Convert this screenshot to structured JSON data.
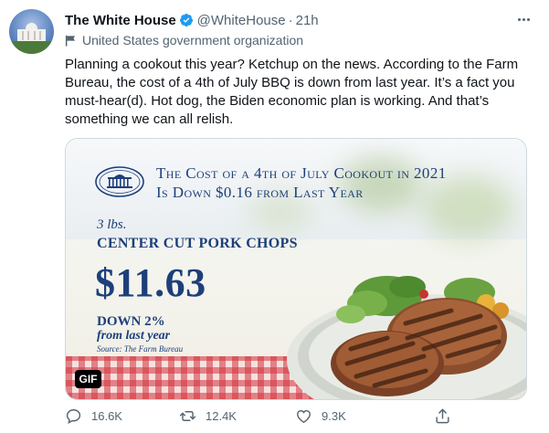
{
  "tweet": {
    "author_name": "The White House",
    "handle": "@WhiteHouse",
    "separator": "·",
    "time": "21h",
    "label": "United States government organization",
    "text": "Planning a cookout this year? Ketchup on the news. According to the Farm Bureau, the cost of a 4th of July BBQ is down from last year. It’s a fact you must-hear(d). Hot dog, the Biden economic plan is working. And that’s something we can all relish."
  },
  "media": {
    "headline_line1": "The Cost of a 4th of July Cookout in 2021",
    "headline_line2": "Is Down $0.16 from Last Year",
    "quantity": "3 lbs.",
    "item": "CENTER CUT PORK CHOPS",
    "price": "$11.63",
    "change": "DOWN 2%",
    "change_since": "from last year",
    "source": "Source: The Farm Bureau",
    "badge": "GIF"
  },
  "actions": {
    "replies": "16.6K",
    "retweets": "12.4K",
    "likes": "9.3K"
  },
  "colors": {
    "text_primary": "#0f1419",
    "text_secondary": "#536471",
    "verified_blue": "#1d9bf0",
    "infographic_navy": "#1d3f7a",
    "tablecloth_red": "#d2323c"
  },
  "icons": [
    "verified-badge-icon",
    "flag-icon",
    "more-icon",
    "reply-icon",
    "retweet-icon",
    "like-icon",
    "share-icon"
  ]
}
